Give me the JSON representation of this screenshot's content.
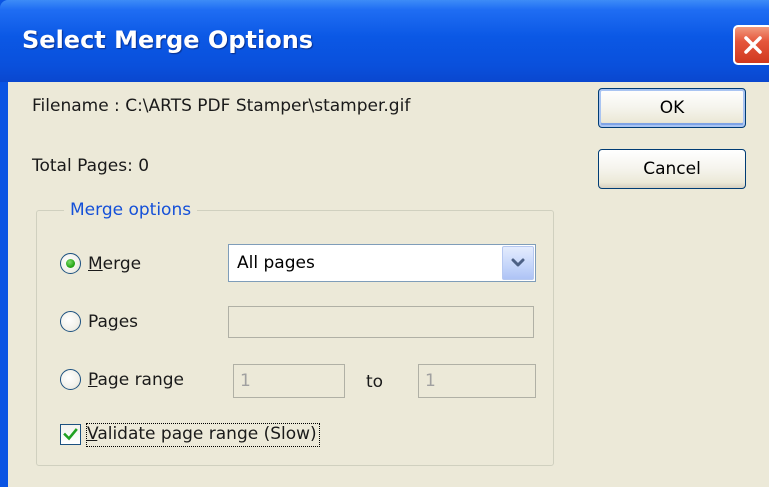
{
  "window": {
    "title": "Select Merge Options"
  },
  "info": {
    "filename_label": "Filename : C:\\ARTS PDF Stamper\\stamper.gif",
    "total_pages_label": "Total Pages: 0"
  },
  "buttons": {
    "ok_label": "OK",
    "cancel_label": "Cancel"
  },
  "merge_options": {
    "group_label": "Merge options",
    "merge": {
      "label_accel": "M",
      "label_rest": "erge",
      "selected": true,
      "dropdown_value": "All pages"
    },
    "pages": {
      "label_pre": "Pa",
      "label_accel": "g",
      "label_rest": "es",
      "value": ""
    },
    "page_range": {
      "label_accel": "P",
      "label_rest": "age range",
      "from_value": "1",
      "to_label": "to",
      "to_value": "1"
    },
    "validate": {
      "label_accel": "V",
      "label_rest": "alidate page range (Slow)",
      "checked": true
    }
  },
  "icons": {
    "close": "close-icon",
    "dropdown": "chevron-down-icon",
    "check": "checkmark-icon"
  },
  "colors": {
    "titlebar": "#0a54e3",
    "dialog_bg": "#ece9d8",
    "group_label": "#1450d8",
    "close_button": "#d0381f",
    "radio_dot": "#2aa81a"
  }
}
